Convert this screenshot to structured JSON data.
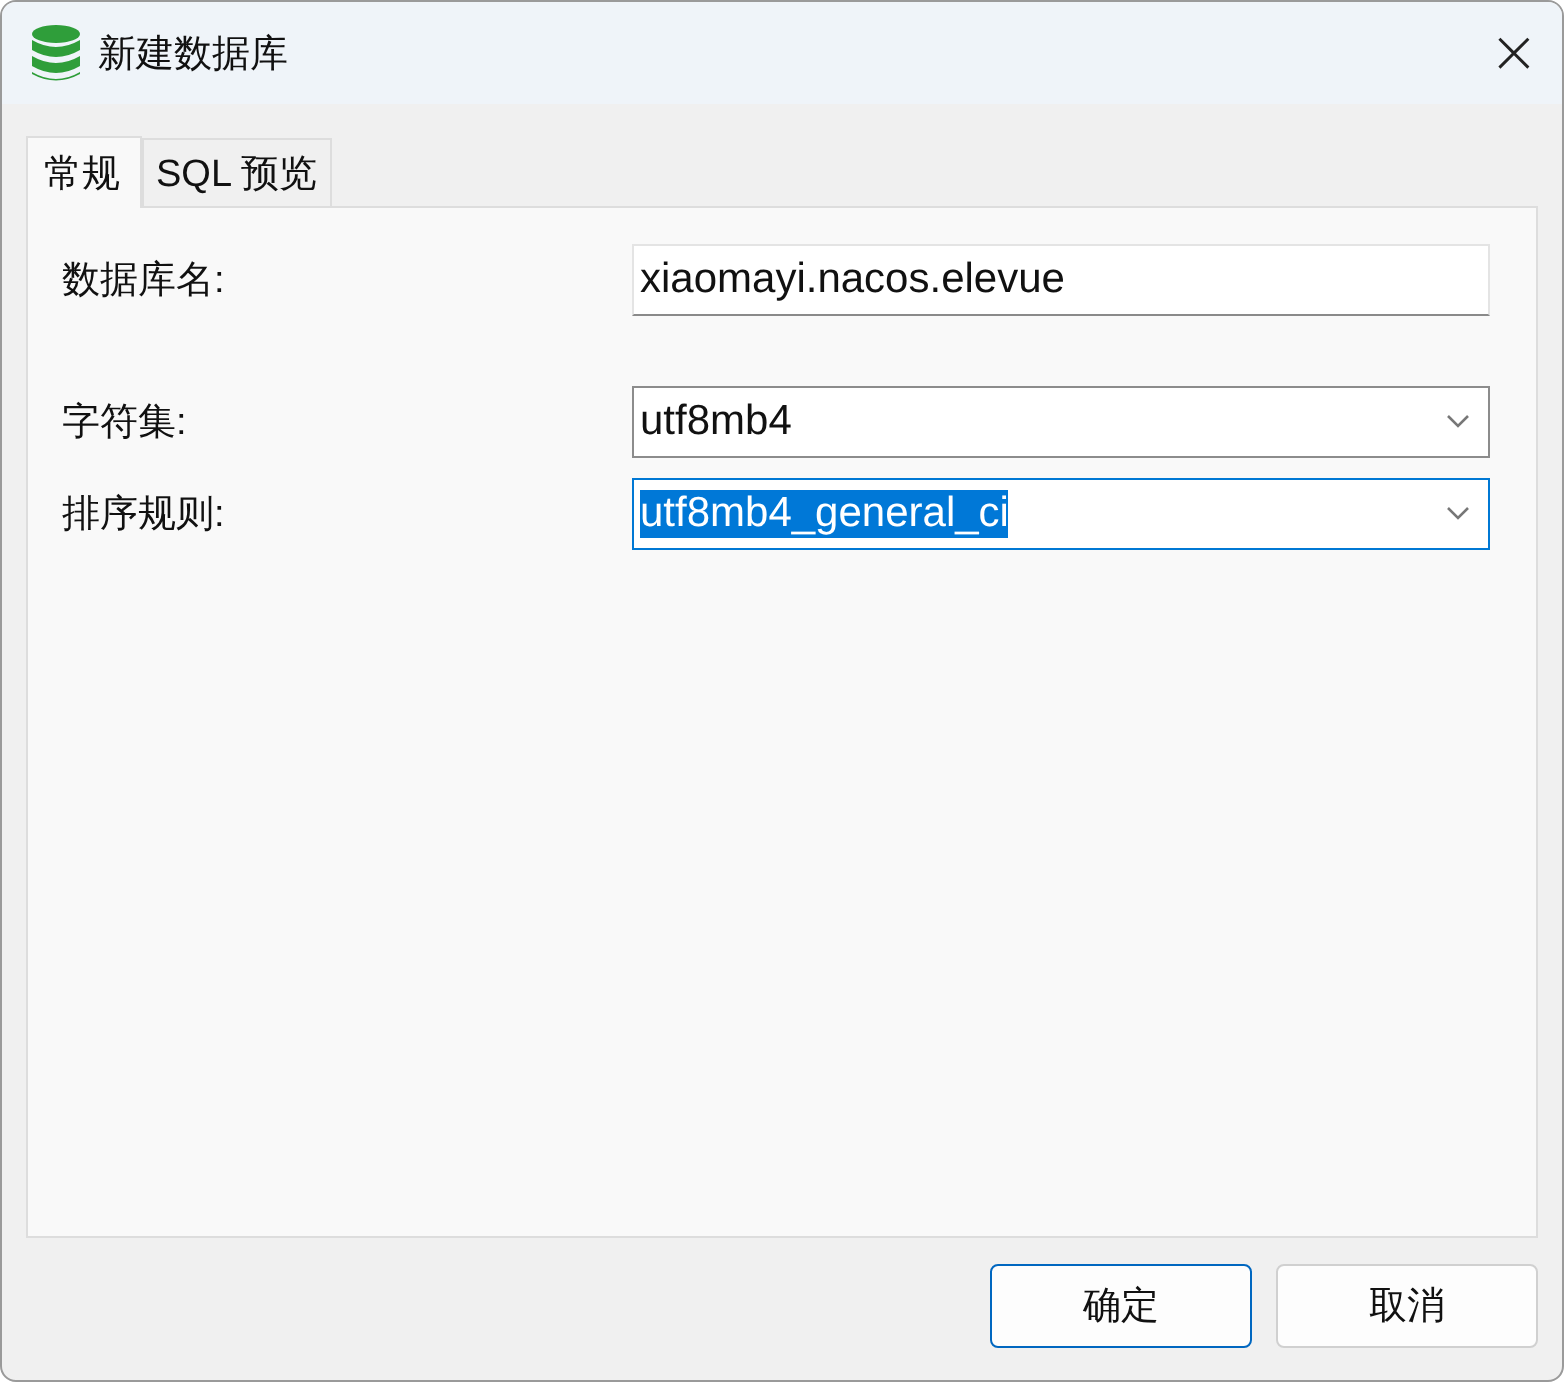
{
  "window": {
    "title": "新建数据库",
    "close": "×"
  },
  "tabs": [
    {
      "label": "常规",
      "selected": true
    },
    {
      "label": "SQL 预览",
      "selected": false
    }
  ],
  "fields": [
    {
      "kind": "text",
      "label": "数据库名:",
      "value": "xiaomayi.nacos.elevue",
      "focused": false
    },
    {
      "kind": "dropdown",
      "label": "字符集:",
      "value": "utf8mb4",
      "focused": false
    },
    {
      "kind": "dropdown",
      "label": "排序规则:",
      "value": "utf8mb4_general_ci",
      "focused": true
    }
  ],
  "buttons": [
    {
      "label": "确定",
      "default": true
    },
    {
      "label": "取消",
      "default": false
    }
  ]
}
